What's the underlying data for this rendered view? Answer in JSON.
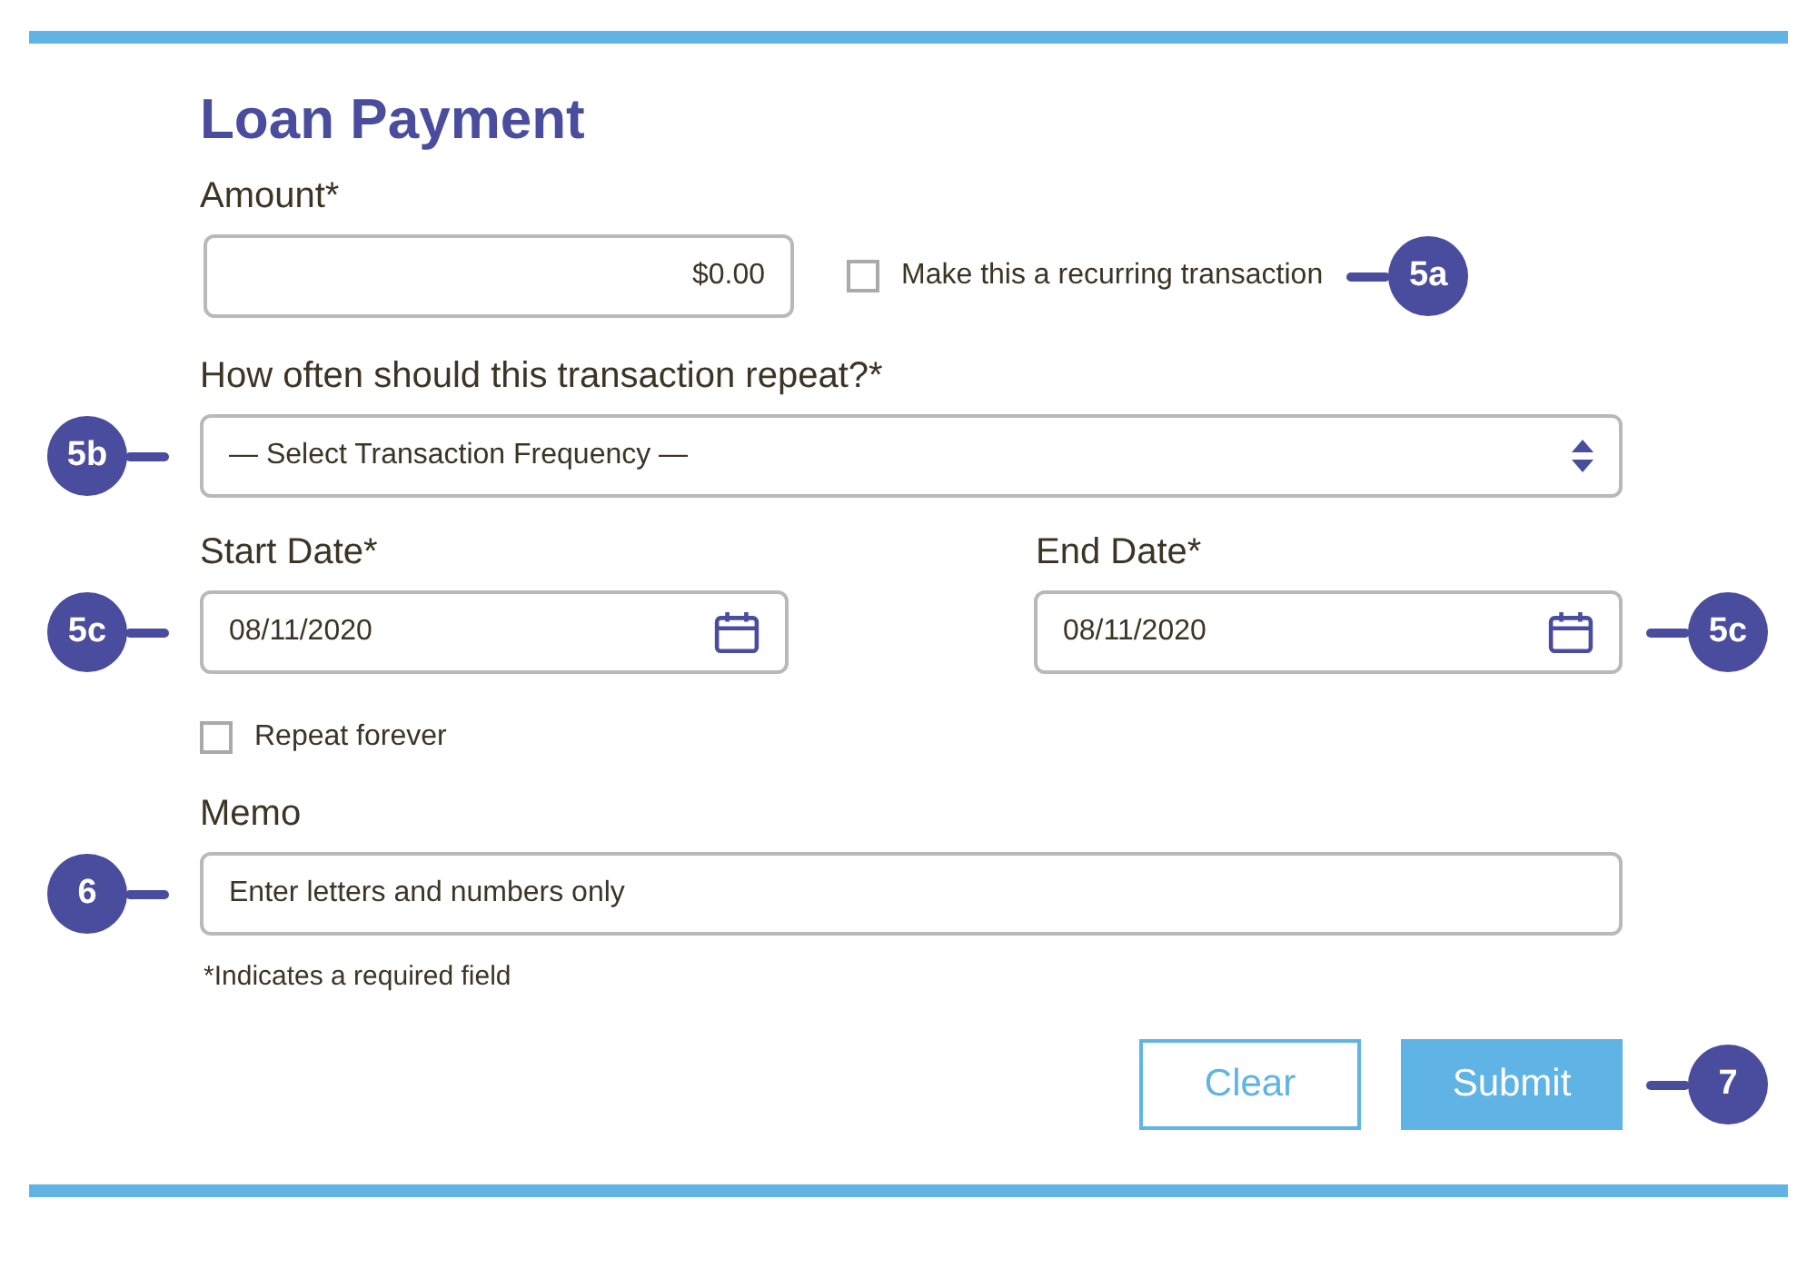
{
  "title": "Loan Payment",
  "amount": {
    "label": "Amount*",
    "value": "$0.00"
  },
  "recurring": {
    "label": "Make this a recurring transaction",
    "checked": false,
    "callout": "5a"
  },
  "frequency": {
    "label": "How often should this transaction repeat?*",
    "placeholder": "— Select Transaction Frequency —",
    "callout": "5b"
  },
  "start_date": {
    "label": "Start Date*",
    "value": "08/11/2020",
    "callout": "5c"
  },
  "end_date": {
    "label": "End Date*",
    "value": "08/11/2020",
    "callout": "5c"
  },
  "repeat_forever": {
    "label": "Repeat forever",
    "checked": false
  },
  "memo": {
    "label": "Memo",
    "placeholder": "Enter letters and numbers only",
    "callout": "6"
  },
  "required_note": "*Indicates a required field",
  "buttons": [
    {
      "label": "Clear",
      "kind": "secondary"
    },
    {
      "label": "Submit",
      "kind": "primary",
      "callout": "7"
    }
  ]
}
